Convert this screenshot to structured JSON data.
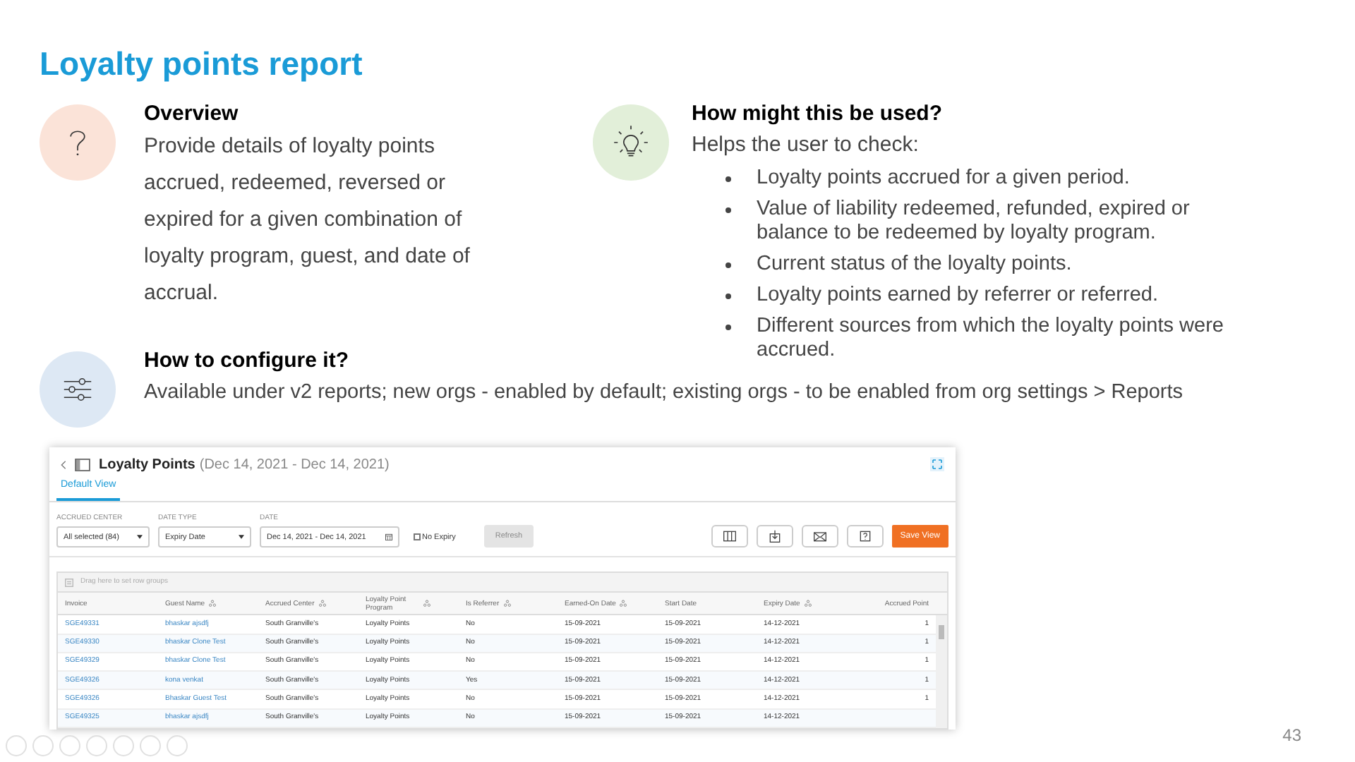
{
  "title": "Loyalty points report",
  "overview": {
    "heading": "Overview",
    "text": "Provide details of loyalty points accrued, redeemed, reversed or expired for a given combination of loyalty program, guest, and date of accrual."
  },
  "usage": {
    "heading": "How might this be used?",
    "intro": "Helps the user to check:",
    "bullets": [
      "Loyalty points accrued for a given period.",
      "Value of liability redeemed, refunded, expired or balance to be redeemed by loyalty program.",
      "Current status of the loyalty points.",
      "Loyalty points earned by referrer or referred.",
      "Different sources from which the loyalty points were accrued."
    ]
  },
  "configure": {
    "heading": "How to configure it?",
    "text": "Available under v2 reports; new orgs - enabled by default; existing orgs  - to be enabled from org settings > Reports"
  },
  "report": {
    "title": "Loyalty Points",
    "date_range": "(Dec 14, 2021 - Dec 14, 2021)",
    "tabs": [
      {
        "label": "Default View",
        "selected": true
      }
    ],
    "filters": [
      {
        "label": "ACCRUED CENTER",
        "value": "All selected (84)",
        "kind": "dropdown"
      },
      {
        "label": "DATE TYPE",
        "value": "Expiry Date",
        "kind": "dropdown"
      },
      {
        "label": "DATE",
        "value": "Dec 14, 2021 - Dec 14, 2021",
        "kind": "date"
      }
    ],
    "no_expiry": {
      "label": "No Expiry",
      "checked": false
    },
    "refresh_button": {
      "label": "Refresh",
      "disabled": true
    },
    "save_button": "Save View",
    "group_hint": "Drag here to set row groups",
    "columns": [
      {
        "label": "Invoice",
        "groupable": false
      },
      {
        "label": "Guest Name",
        "groupable": true
      },
      {
        "label": "Accrued Center",
        "groupable": true
      },
      {
        "label": "Loyalty Point Program",
        "groupable": true
      },
      {
        "label": "Is Referrer",
        "groupable": true
      },
      {
        "label": "Earned-On Date",
        "groupable": true
      },
      {
        "label": "Start Date",
        "groupable": false
      },
      {
        "label": "Expiry Date",
        "groupable": true
      },
      {
        "label": "Accrued Point",
        "groupable": false
      }
    ],
    "rows": [
      [
        "SGE49331",
        "bhaskar ajsdfj",
        "South Granville's",
        "Loyalty Points",
        "No",
        "15-09-2021",
        "15-09-2021",
        "14-12-2021",
        "1"
      ],
      [
        "SGE49330",
        "bhaskar Clone Test",
        "South Granville's",
        "Loyalty Points",
        "No",
        "15-09-2021",
        "15-09-2021",
        "14-12-2021",
        "1"
      ],
      [
        "SGE49329",
        "bhaskar Clone Test",
        "South Granville's",
        "Loyalty Points",
        "No",
        "15-09-2021",
        "15-09-2021",
        "14-12-2021",
        "1"
      ],
      [
        "SGE49326",
        "kona venkat",
        "South Granville's",
        "Loyalty Points",
        "Yes",
        "15-09-2021",
        "15-09-2021",
        "14-12-2021",
        "1"
      ],
      [
        "SGE49326",
        "Bhaskar Guest Test",
        "South Granville's",
        "Loyalty Points",
        "No",
        "15-09-2021",
        "15-09-2021",
        "14-12-2021",
        "1"
      ],
      [
        "SGE49325",
        "bhaskar ajsdfj",
        "South Granville's",
        "Loyalty Points",
        "No",
        "15-09-2021",
        "15-09-2021",
        "14-12-2021"
      ]
    ]
  },
  "page_number": "43"
}
